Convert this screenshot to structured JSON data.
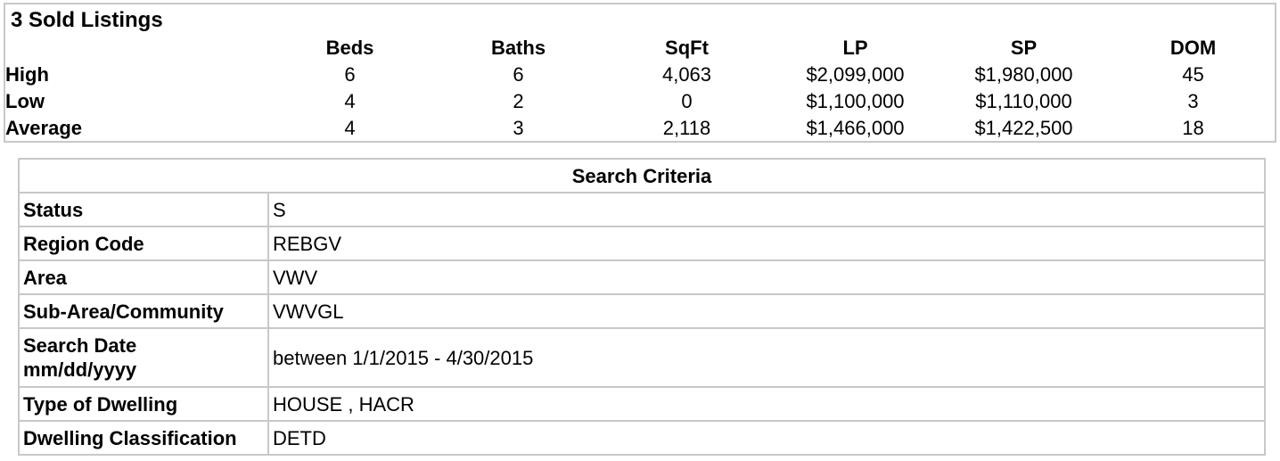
{
  "summary": {
    "title": "3 Sold Listings",
    "columns": [
      "Beds",
      "Baths",
      "SqFt",
      "LP",
      "SP",
      "DOM"
    ],
    "rows": [
      {
        "label": "High",
        "values": [
          "6",
          "6",
          "4,063",
          "$2,099,000",
          "$1,980,000",
          "45"
        ]
      },
      {
        "label": "Low",
        "values": [
          "4",
          "2",
          "0",
          "$1,100,000",
          "$1,110,000",
          "3"
        ]
      },
      {
        "label": "Average",
        "values": [
          "4",
          "3",
          "2,118",
          "$1,466,000",
          "$1,422,500",
          "18"
        ]
      }
    ]
  },
  "criteria": {
    "header": "Search Criteria",
    "rows": [
      {
        "label": "Status",
        "value": "S"
      },
      {
        "label": "Region Code",
        "value": "REBGV"
      },
      {
        "label": "Area",
        "value": "VWV"
      },
      {
        "label": "Sub-Area/Community",
        "value": "VWVGL"
      },
      {
        "label_line1": "Search Date",
        "label_line2": "mm/dd/yyyy",
        "value": "between 1/1/2015 - 4/30/2015"
      },
      {
        "label": "Type of Dwelling",
        "value": "HOUSE , HACR"
      },
      {
        "label": "Dwelling Classification",
        "value": "DETD"
      }
    ]
  }
}
